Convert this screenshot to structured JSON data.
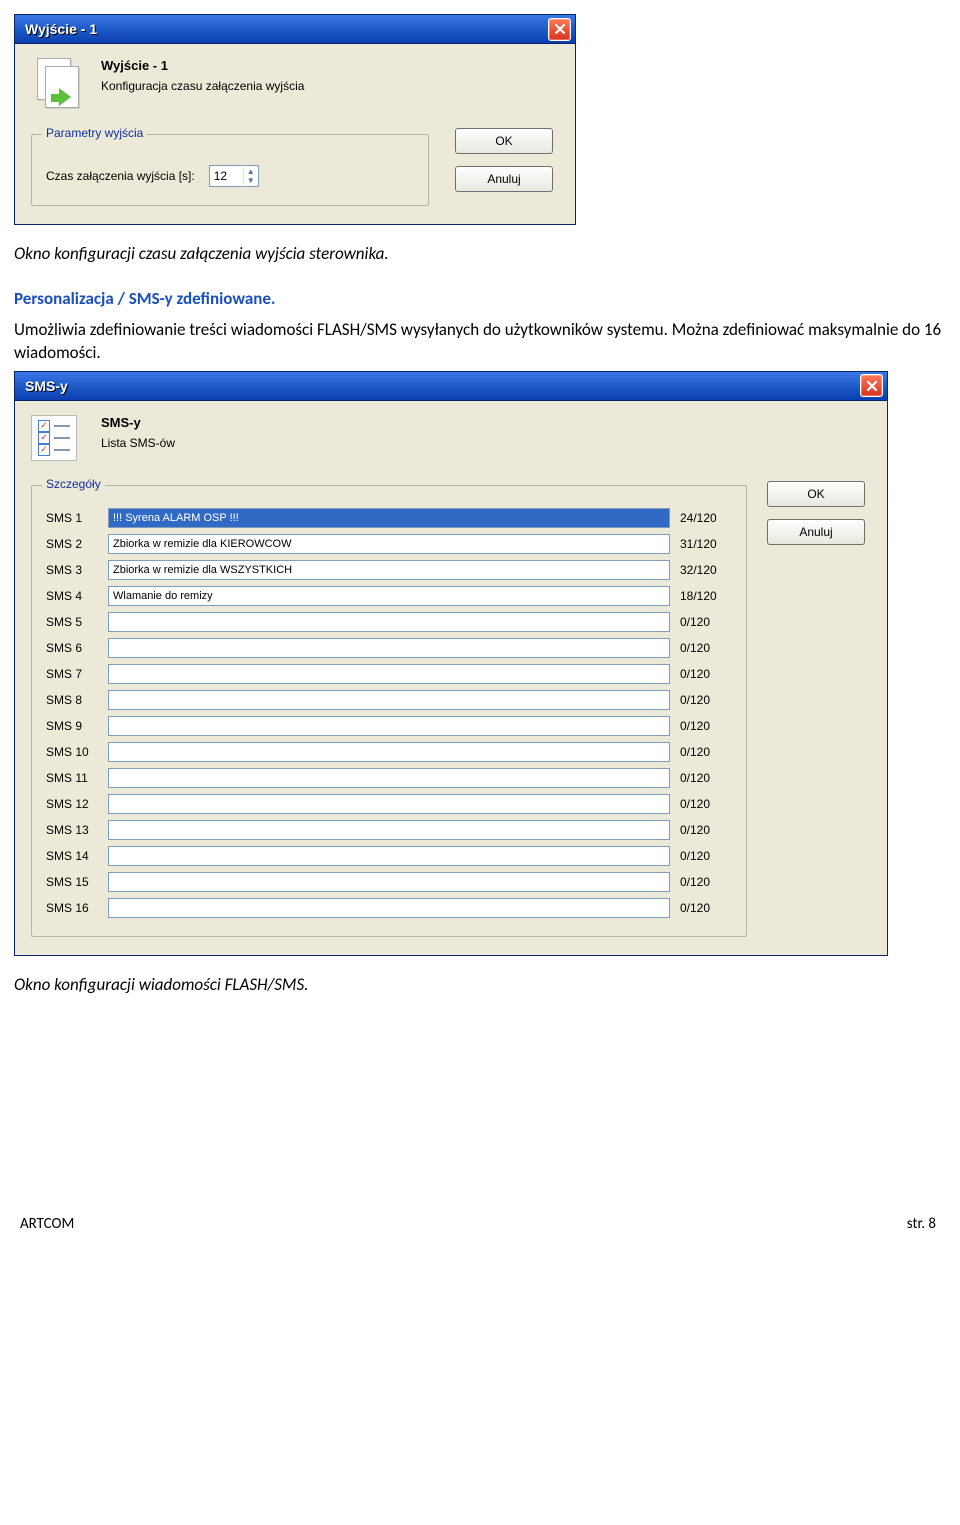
{
  "window1": {
    "title": "Wyjście - 1",
    "header_title": "Wyjście - 1",
    "header_sub": "Konfiguracja czasu załączenia wyjścia",
    "group_legend": "Parametry wyjścia",
    "field_label": "Czas załączenia wyjścia [s]:",
    "field_value": "12",
    "ok": "OK",
    "cancel": "Anuluj"
  },
  "caption1": "Okno konfiguracji czasu załączenia wyjścia sterownika.",
  "section_link": "Personalizacja / SMS-y zdefiniowane.",
  "para1": "Umożliwia zdefiniowanie treści wiadomości FLASH/SMS wysyłanych do użytkowników systemu. Można zdefiniować maksymalnie do 16 wiadomości.",
  "window2": {
    "title": "SMS-y",
    "header_title": "SMS-y",
    "header_sub": "Lista SMS-ów",
    "group_legend": "Szczegóły",
    "ok": "OK",
    "cancel": "Anuluj",
    "sms_label_prefix": "SMS",
    "rows": [
      {
        "n": "1",
        "text": "!!! Syrena ALARM OSP !!!",
        "count": "24/120",
        "selected": true
      },
      {
        "n": "2",
        "text": "Zbiorka w remizie dla KIEROWCOW",
        "count": "31/120",
        "selected": false
      },
      {
        "n": "3",
        "text": "Zbiorka w remizie dla WSZYSTKICH",
        "count": "32/120",
        "selected": false
      },
      {
        "n": "4",
        "text": "Wlamanie do remizy",
        "count": "18/120",
        "selected": false
      },
      {
        "n": "5",
        "text": "",
        "count": "0/120",
        "selected": false
      },
      {
        "n": "6",
        "text": "",
        "count": "0/120",
        "selected": false
      },
      {
        "n": "7",
        "text": "",
        "count": "0/120",
        "selected": false
      },
      {
        "n": "8",
        "text": "",
        "count": "0/120",
        "selected": false
      },
      {
        "n": "9",
        "text": "",
        "count": "0/120",
        "selected": false
      },
      {
        "n": "10",
        "text": "",
        "count": "0/120",
        "selected": false
      },
      {
        "n": "11",
        "text": "",
        "count": "0/120",
        "selected": false
      },
      {
        "n": "12",
        "text": "",
        "count": "0/120",
        "selected": false
      },
      {
        "n": "13",
        "text": "",
        "count": "0/120",
        "selected": false
      },
      {
        "n": "14",
        "text": "",
        "count": "0/120",
        "selected": false
      },
      {
        "n": "15",
        "text": "",
        "count": "0/120",
        "selected": false
      },
      {
        "n": "16",
        "text": "",
        "count": "0/120",
        "selected": false
      }
    ]
  },
  "caption2": "Okno konfiguracji wiadomości FLASH/SMS.",
  "footer": {
    "left": "ARTCOM",
    "right": "str. 8"
  }
}
